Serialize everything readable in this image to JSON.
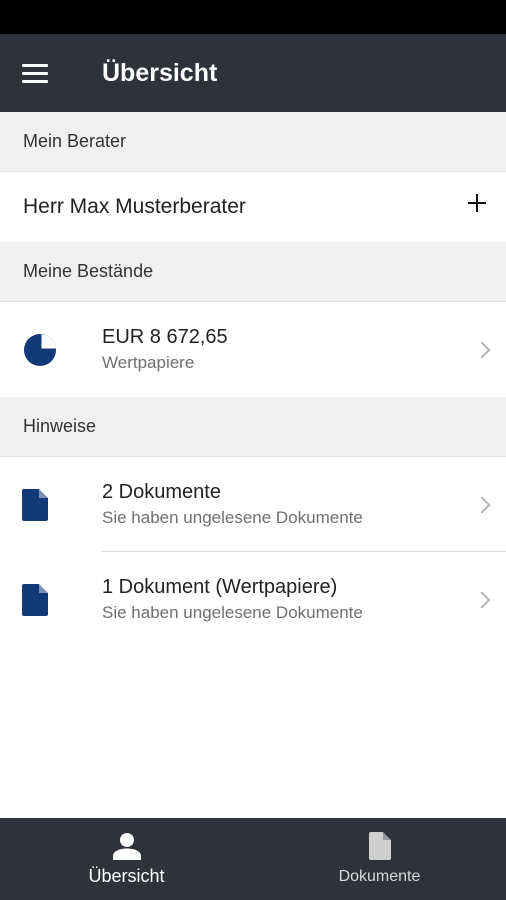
{
  "app_bar": {
    "title": "Übersicht"
  },
  "sections": {
    "advisor_header": "Mein Berater",
    "advisor_name": "Herr Max Musterberater",
    "holdings_header": "Meine Bestände",
    "holdings_amount": "EUR 8 672,65",
    "holdings_type": "Wertpapiere",
    "notes_header": "Hinweise",
    "notes": [
      {
        "title": "2 Dokumente",
        "subtitle": "Sie haben ungelesene Dokumente"
      },
      {
        "title": "1 Dokument (Wertpapiere)",
        "subtitle": "Sie haben ungelesene Dokumente"
      }
    ]
  },
  "bottom_nav": {
    "overview_label": "Übersicht",
    "documents_label": "Dokumente"
  },
  "colors": {
    "bar": "#2f3239",
    "accent": "#123a78",
    "section_bg": "#f0f0f0"
  },
  "icons": [
    "menu-icon",
    "plus-icon",
    "pie-chart-icon",
    "document-icon",
    "chevron-right-icon",
    "person-icon"
  ]
}
